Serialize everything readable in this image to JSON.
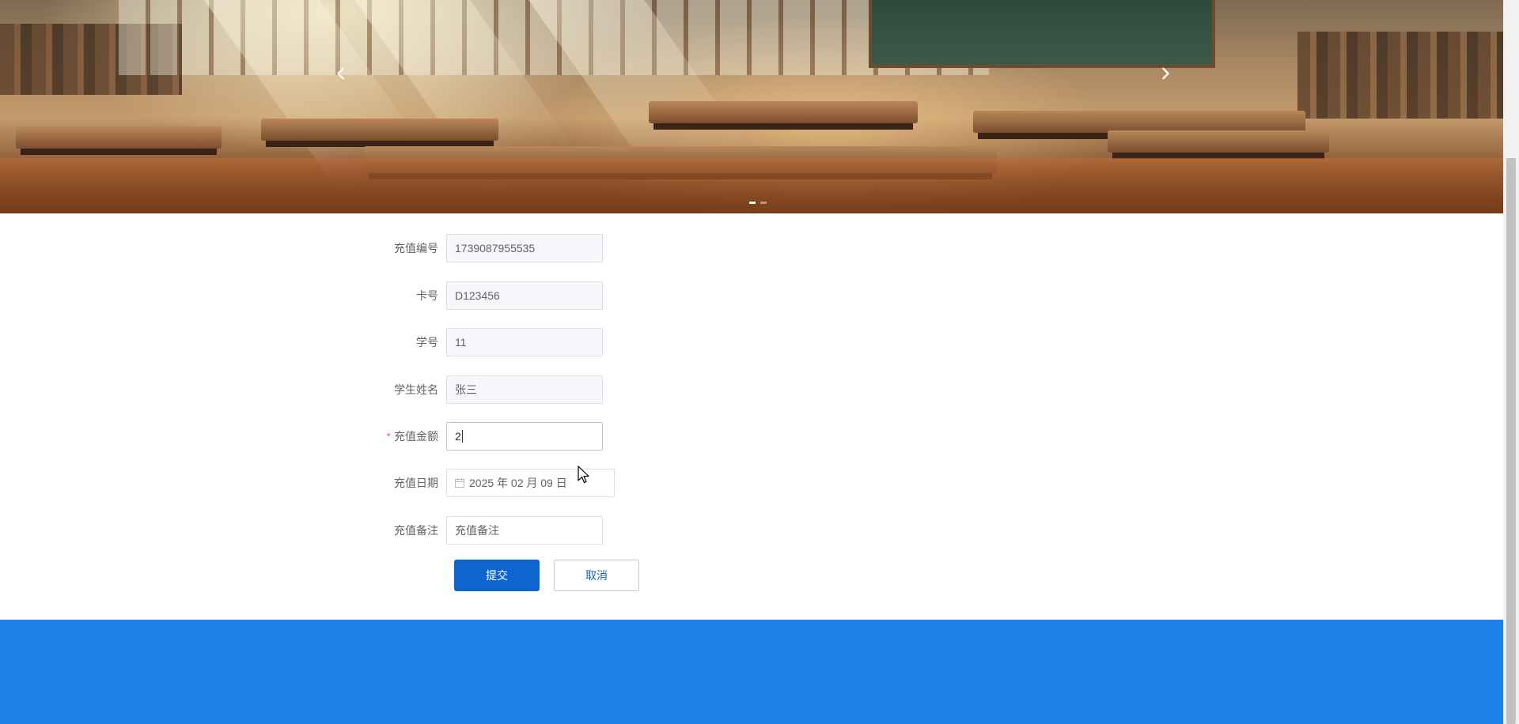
{
  "banner": {
    "prev_icon": "chevron-left-icon",
    "next_icon": "chevron-right-icon",
    "slide_count": 2,
    "active_slide": 1
  },
  "form": {
    "fields": [
      {
        "label": "充值编号",
        "value": "1739087955535",
        "disabled": true,
        "required": false
      },
      {
        "label": "卡号",
        "value": "D123456",
        "disabled": true,
        "required": false
      },
      {
        "label": "学号",
        "value": "11",
        "disabled": true,
        "required": false
      },
      {
        "label": "学生姓名",
        "value": "张三",
        "disabled": true,
        "required": false
      },
      {
        "label": "充值金额",
        "value": "2",
        "disabled": false,
        "required": true
      },
      {
        "label": "充值日期",
        "value": "2025 年 02 月 09 日",
        "disabled": false,
        "required": false,
        "icon": "calendar-icon"
      },
      {
        "label": "充值备注",
        "value": "充值备注",
        "disabled": false,
        "required": false
      }
    ],
    "required_mark": "*",
    "submit_label": "提交",
    "cancel_label": "取消"
  },
  "colors": {
    "primary": "#0d66d0",
    "footer": "#1f82ea",
    "required": "#f56c6c"
  }
}
